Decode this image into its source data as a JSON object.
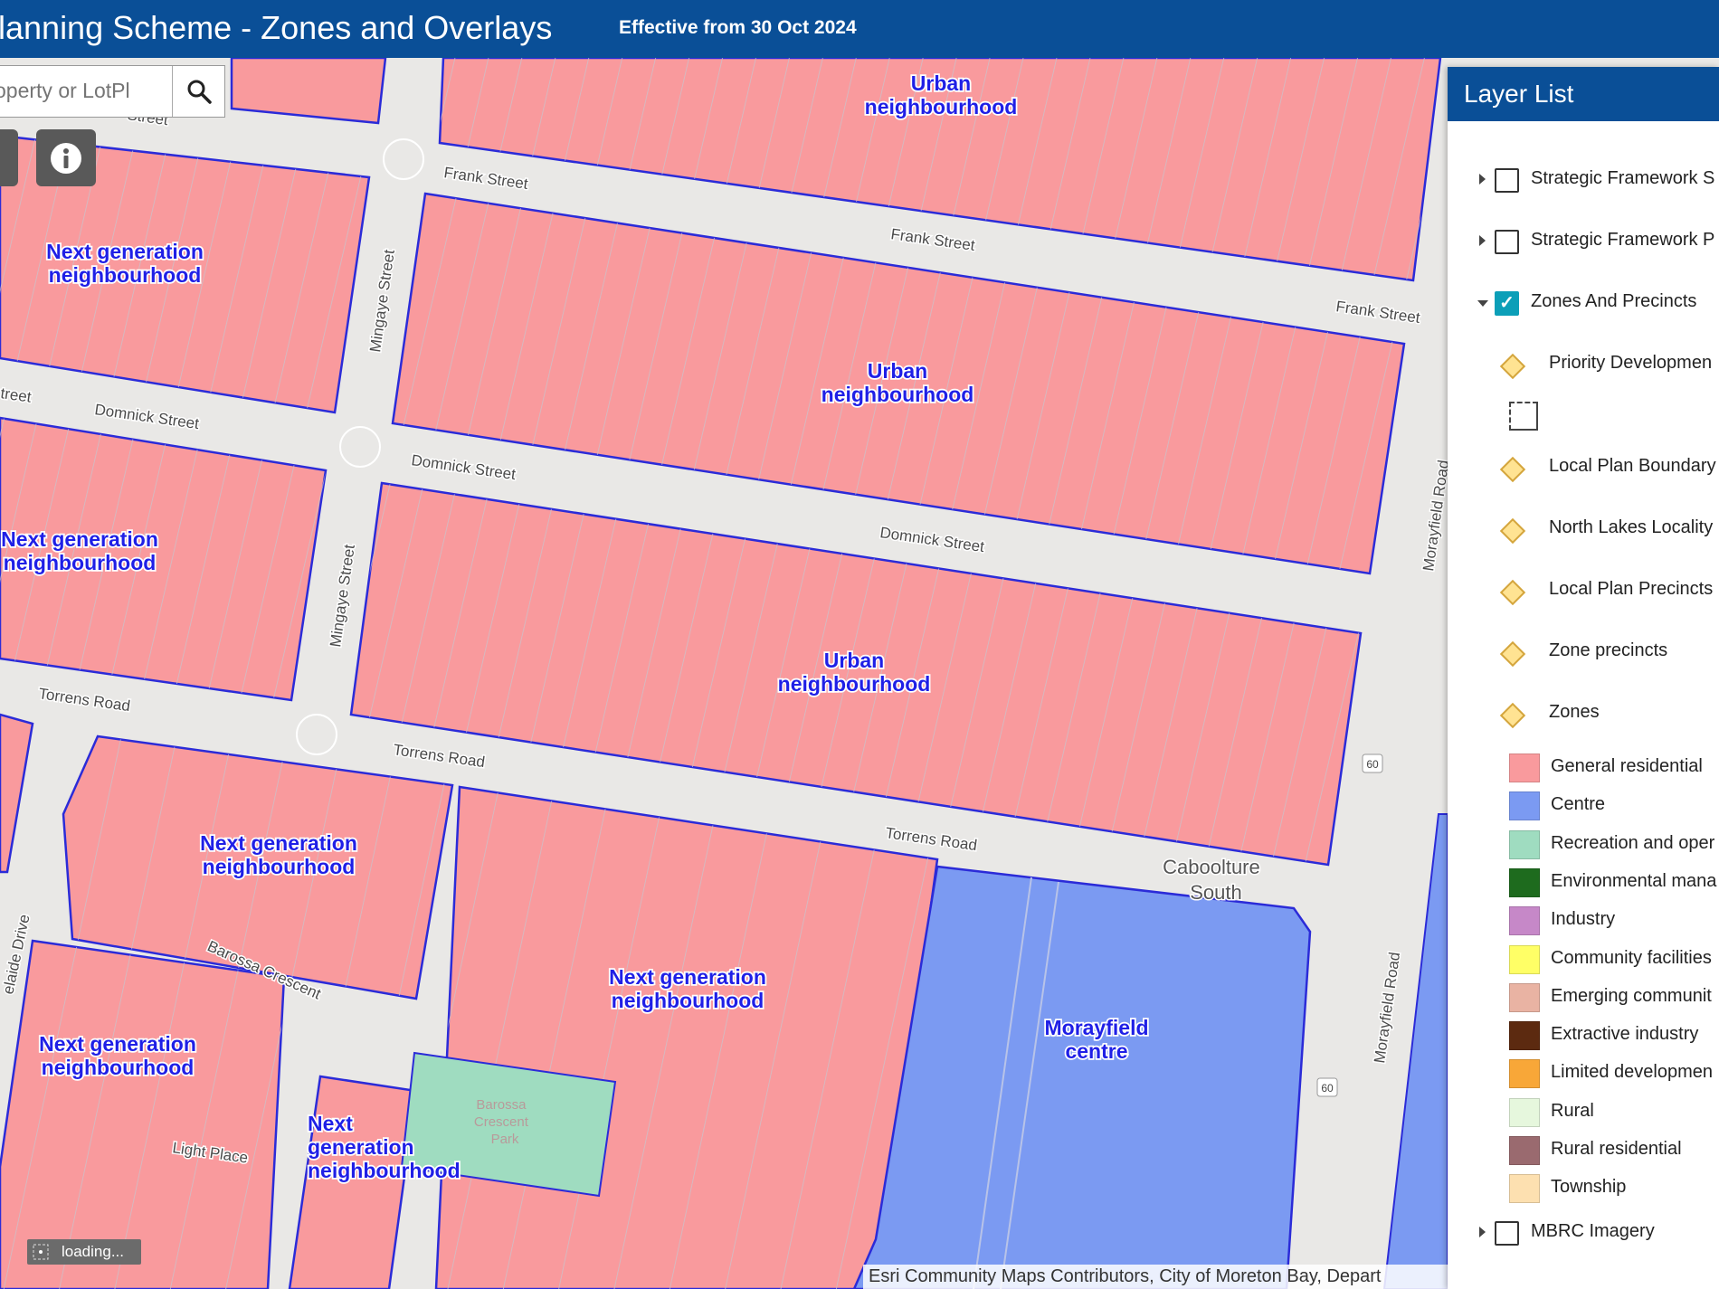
{
  "header": {
    "title": "lanning Scheme - Zones and Overlays",
    "effective": "Effective from 30 Oct 2024"
  },
  "search": {
    "placeholder": "operty or LotPl"
  },
  "map": {
    "zone_labels": [
      "Urban neighbourhood",
      "Next generation neighbourhood",
      "Morayfield centre"
    ],
    "zone_label_lines": {
      "urban": [
        "Urban",
        "neighbourhood"
      ],
      "nextgen": [
        "Next generation",
        "neighbourhood"
      ],
      "nextgen_stacked": [
        "Next",
        "generation",
        "neighbourhood"
      ],
      "morayfield": [
        "Morayfield",
        "centre"
      ]
    },
    "streets": {
      "frank": "Frank Street",
      "domnick": "Domnick Street",
      "torrens": "Torrens Road",
      "mingaye": "Mingaye Street",
      "morayfield": "Morayfield Road",
      "barossa": "Barossa Crescent",
      "light": "Light Place",
      "adelaide": "elaide Drive",
      "street_fragment": "Street",
      "street_fragment2": "treet"
    },
    "locality": [
      "Caboolture",
      "South"
    ],
    "park": [
      "Barossa",
      "Crescent",
      "Park"
    ],
    "route_shield": "60",
    "colors": {
      "general_residential": "#f99a9d",
      "centre": "#7b9af2",
      "recreation": "#9fdcc0",
      "boundary": "#2b2bd8"
    }
  },
  "layer_list": {
    "title": "Layer List",
    "top_layers": [
      {
        "label": "Strategic Framework S",
        "checked": false
      },
      {
        "label": "Strategic Framework P",
        "checked": false
      },
      {
        "label": "Zones And Precincts",
        "checked": true
      }
    ],
    "sublayers": [
      "Priority Developmen",
      "Local Plan Boundary",
      "North Lakes Locality",
      "Local Plan Precincts",
      "Zone precincts",
      "Zones"
    ],
    "legend": [
      {
        "label": "General residential",
        "color": "#f99a9d"
      },
      {
        "label": "Centre",
        "color": "#7b9af2"
      },
      {
        "label": "Recreation and oper",
        "color": "#9fdcc0"
      },
      {
        "label": "Environmental mana",
        "color": "#1e6b1e"
      },
      {
        "label": "Industry",
        "color": "#c688c8"
      },
      {
        "label": "Community facilities",
        "color": "#ffff66"
      },
      {
        "label": "Emerging communit",
        "color": "#e9b3a3"
      },
      {
        "label": "Extractive industry",
        "color": "#5c2a10"
      },
      {
        "label": "Limited developmen",
        "color": "#f8a738"
      },
      {
        "label": "Rural",
        "color": "#e6f7dd"
      },
      {
        "label": "Rural residential",
        "color": "#9a6a6f"
      },
      {
        "label": "Township",
        "color": "#fde0b0"
      }
    ],
    "bottom_layers": [
      {
        "label": "MBRC Imagery",
        "checked": false
      }
    ]
  },
  "attribution": "Esri Community Maps Contributors, City of Moreton Bay, Depart",
  "status": {
    "loading": "loading..."
  }
}
